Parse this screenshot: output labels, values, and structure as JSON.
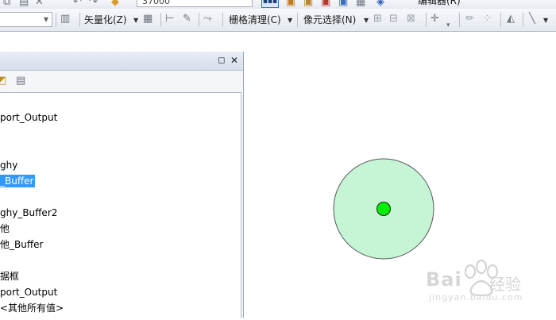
{
  "toolbar": {
    "vectorize_label": "矢量化(Z)",
    "raster_cleanup_label": "栅格清理(C)",
    "cell_selection_label": "像元选择(N)",
    "top_input_value": "37000",
    "editor_label": "编辑器(R)"
  },
  "toc": {
    "items": [
      {
        "label": "port_Output",
        "selected": false
      },
      {
        "label": "ghy",
        "selected": false
      },
      {
        "label": "_Buffer",
        "selected": true
      },
      {
        "label": "ghy_Buffer2",
        "selected": false
      },
      {
        "label": "他",
        "selected": false
      },
      {
        "label": "他_Buffer",
        "selected": false
      },
      {
        "label": "据框",
        "selected": false
      },
      {
        "label": "port_Output",
        "selected": false
      },
      {
        "label": "<其他所有值>",
        "selected": false
      }
    ]
  },
  "map": {
    "buffer_fill": "#c6f5d6",
    "point_fill": "#00ee00"
  },
  "watermark": {
    "brand": "Bai",
    "brand_suffix": "经验",
    "url": "jingyan.baidu.com"
  },
  "colors": {
    "selection": "#3399ff",
    "toolbar_border": "#aeb4bf"
  }
}
